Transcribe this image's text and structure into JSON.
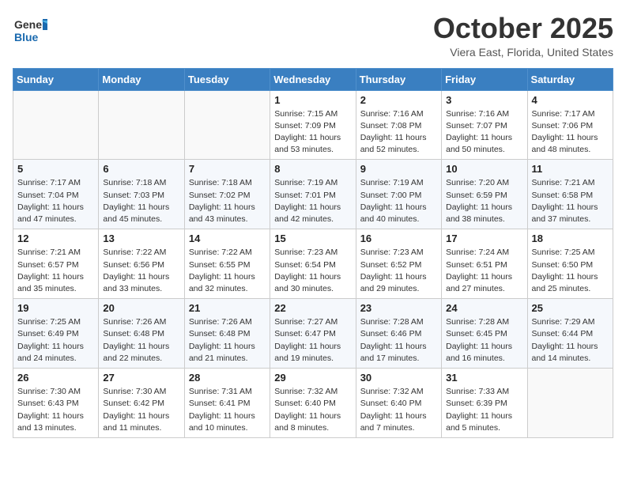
{
  "header": {
    "logo_general": "General",
    "logo_blue": "Blue",
    "month": "October 2025",
    "location": "Viera East, Florida, United States"
  },
  "weekdays": [
    "Sunday",
    "Monday",
    "Tuesday",
    "Wednesday",
    "Thursday",
    "Friday",
    "Saturday"
  ],
  "weeks": [
    [
      {
        "day": "",
        "sunrise": "",
        "sunset": "",
        "daylight": ""
      },
      {
        "day": "",
        "sunrise": "",
        "sunset": "",
        "daylight": ""
      },
      {
        "day": "",
        "sunrise": "",
        "sunset": "",
        "daylight": ""
      },
      {
        "day": "1",
        "sunrise": "Sunrise: 7:15 AM",
        "sunset": "Sunset: 7:09 PM",
        "daylight": "Daylight: 11 hours and 53 minutes."
      },
      {
        "day": "2",
        "sunrise": "Sunrise: 7:16 AM",
        "sunset": "Sunset: 7:08 PM",
        "daylight": "Daylight: 11 hours and 52 minutes."
      },
      {
        "day": "3",
        "sunrise": "Sunrise: 7:16 AM",
        "sunset": "Sunset: 7:07 PM",
        "daylight": "Daylight: 11 hours and 50 minutes."
      },
      {
        "day": "4",
        "sunrise": "Sunrise: 7:17 AM",
        "sunset": "Sunset: 7:06 PM",
        "daylight": "Daylight: 11 hours and 48 minutes."
      }
    ],
    [
      {
        "day": "5",
        "sunrise": "Sunrise: 7:17 AM",
        "sunset": "Sunset: 7:04 PM",
        "daylight": "Daylight: 11 hours and 47 minutes."
      },
      {
        "day": "6",
        "sunrise": "Sunrise: 7:18 AM",
        "sunset": "Sunset: 7:03 PM",
        "daylight": "Daylight: 11 hours and 45 minutes."
      },
      {
        "day": "7",
        "sunrise": "Sunrise: 7:18 AM",
        "sunset": "Sunset: 7:02 PM",
        "daylight": "Daylight: 11 hours and 43 minutes."
      },
      {
        "day": "8",
        "sunrise": "Sunrise: 7:19 AM",
        "sunset": "Sunset: 7:01 PM",
        "daylight": "Daylight: 11 hours and 42 minutes."
      },
      {
        "day": "9",
        "sunrise": "Sunrise: 7:19 AM",
        "sunset": "Sunset: 7:00 PM",
        "daylight": "Daylight: 11 hours and 40 minutes."
      },
      {
        "day": "10",
        "sunrise": "Sunrise: 7:20 AM",
        "sunset": "Sunset: 6:59 PM",
        "daylight": "Daylight: 11 hours and 38 minutes."
      },
      {
        "day": "11",
        "sunrise": "Sunrise: 7:21 AM",
        "sunset": "Sunset: 6:58 PM",
        "daylight": "Daylight: 11 hours and 37 minutes."
      }
    ],
    [
      {
        "day": "12",
        "sunrise": "Sunrise: 7:21 AM",
        "sunset": "Sunset: 6:57 PM",
        "daylight": "Daylight: 11 hours and 35 minutes."
      },
      {
        "day": "13",
        "sunrise": "Sunrise: 7:22 AM",
        "sunset": "Sunset: 6:56 PM",
        "daylight": "Daylight: 11 hours and 33 minutes."
      },
      {
        "day": "14",
        "sunrise": "Sunrise: 7:22 AM",
        "sunset": "Sunset: 6:55 PM",
        "daylight": "Daylight: 11 hours and 32 minutes."
      },
      {
        "day": "15",
        "sunrise": "Sunrise: 7:23 AM",
        "sunset": "Sunset: 6:54 PM",
        "daylight": "Daylight: 11 hours and 30 minutes."
      },
      {
        "day": "16",
        "sunrise": "Sunrise: 7:23 AM",
        "sunset": "Sunset: 6:52 PM",
        "daylight": "Daylight: 11 hours and 29 minutes."
      },
      {
        "day": "17",
        "sunrise": "Sunrise: 7:24 AM",
        "sunset": "Sunset: 6:51 PM",
        "daylight": "Daylight: 11 hours and 27 minutes."
      },
      {
        "day": "18",
        "sunrise": "Sunrise: 7:25 AM",
        "sunset": "Sunset: 6:50 PM",
        "daylight": "Daylight: 11 hours and 25 minutes."
      }
    ],
    [
      {
        "day": "19",
        "sunrise": "Sunrise: 7:25 AM",
        "sunset": "Sunset: 6:49 PM",
        "daylight": "Daylight: 11 hours and 24 minutes."
      },
      {
        "day": "20",
        "sunrise": "Sunrise: 7:26 AM",
        "sunset": "Sunset: 6:48 PM",
        "daylight": "Daylight: 11 hours and 22 minutes."
      },
      {
        "day": "21",
        "sunrise": "Sunrise: 7:26 AM",
        "sunset": "Sunset: 6:48 PM",
        "daylight": "Daylight: 11 hours and 21 minutes."
      },
      {
        "day": "22",
        "sunrise": "Sunrise: 7:27 AM",
        "sunset": "Sunset: 6:47 PM",
        "daylight": "Daylight: 11 hours and 19 minutes."
      },
      {
        "day": "23",
        "sunrise": "Sunrise: 7:28 AM",
        "sunset": "Sunset: 6:46 PM",
        "daylight": "Daylight: 11 hours and 17 minutes."
      },
      {
        "day": "24",
        "sunrise": "Sunrise: 7:28 AM",
        "sunset": "Sunset: 6:45 PM",
        "daylight": "Daylight: 11 hours and 16 minutes."
      },
      {
        "day": "25",
        "sunrise": "Sunrise: 7:29 AM",
        "sunset": "Sunset: 6:44 PM",
        "daylight": "Daylight: 11 hours and 14 minutes."
      }
    ],
    [
      {
        "day": "26",
        "sunrise": "Sunrise: 7:30 AM",
        "sunset": "Sunset: 6:43 PM",
        "daylight": "Daylight: 11 hours and 13 minutes."
      },
      {
        "day": "27",
        "sunrise": "Sunrise: 7:30 AM",
        "sunset": "Sunset: 6:42 PM",
        "daylight": "Daylight: 11 hours and 11 minutes."
      },
      {
        "day": "28",
        "sunrise": "Sunrise: 7:31 AM",
        "sunset": "Sunset: 6:41 PM",
        "daylight": "Daylight: 11 hours and 10 minutes."
      },
      {
        "day": "29",
        "sunrise": "Sunrise: 7:32 AM",
        "sunset": "Sunset: 6:40 PM",
        "daylight": "Daylight: 11 hours and 8 minutes."
      },
      {
        "day": "30",
        "sunrise": "Sunrise: 7:32 AM",
        "sunset": "Sunset: 6:40 PM",
        "daylight": "Daylight: 11 hours and 7 minutes."
      },
      {
        "day": "31",
        "sunrise": "Sunrise: 7:33 AM",
        "sunset": "Sunset: 6:39 PM",
        "daylight": "Daylight: 11 hours and 5 minutes."
      },
      {
        "day": "",
        "sunrise": "",
        "sunset": "",
        "daylight": ""
      }
    ]
  ]
}
